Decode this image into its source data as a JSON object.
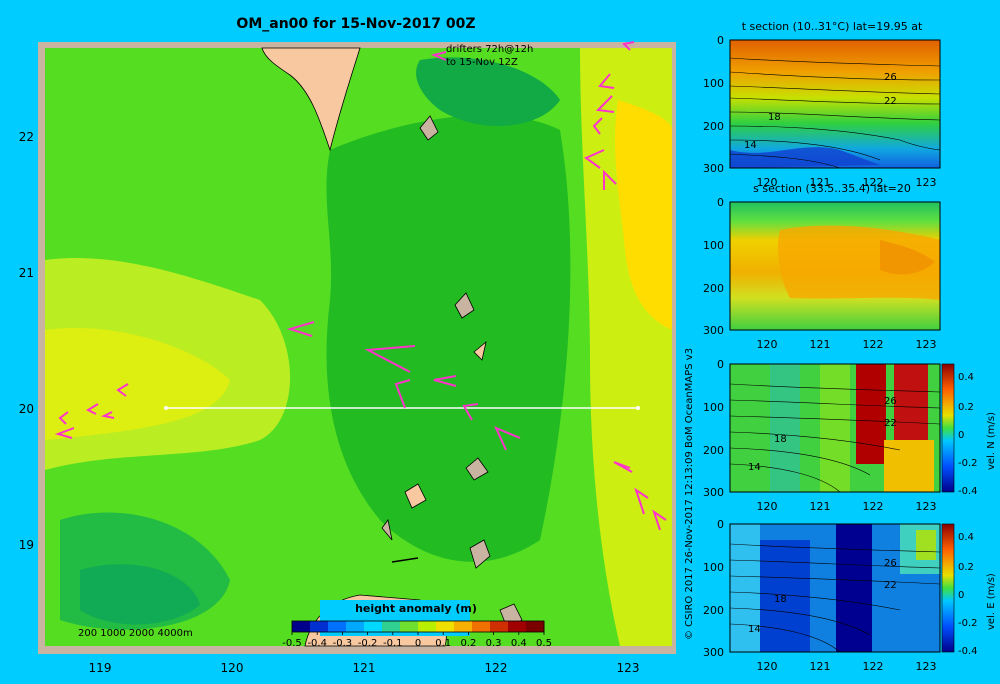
{
  "main_map": {
    "title": "OM_an00 for 15-Nov-2017 00Z",
    "drifters_line1": "drifters 72h@12h",
    "drifters_line2": "to 15-Nov 12Z",
    "lat_ticks": [
      "22",
      "21",
      "20",
      "19"
    ],
    "lon_ticks": [
      "119",
      "120",
      "121",
      "122",
      "123"
    ],
    "depth_legend": "200  1000  2000  4000m",
    "colorbar_title": "height anomaly  (m)",
    "colorbar_ticks": [
      "-0.5",
      "-0.4",
      "-0.3",
      "-0.2",
      "-0.1",
      "0",
      "0.1",
      "0.2",
      "0.3",
      "0.4",
      "0.5"
    ]
  },
  "credit": "© CSIRO 2017   26-Nov-2017 12:13:09 BoM OceanMAPS v3",
  "panels": [
    {
      "title": "t section (10..31°C) lat=19.95 at",
      "y_ticks": [
        "0",
        "100",
        "200",
        "300"
      ],
      "x_ticks": [
        "120",
        "121",
        "122",
        "123"
      ],
      "contour_labels": [
        "26",
        "22",
        "18",
        "14"
      ]
    },
    {
      "title": "s section (33.5..35.4) lat=20",
      "y_ticks": [
        "0",
        "100",
        "200",
        "300"
      ],
      "x_ticks": [
        "120",
        "121",
        "122",
        "123"
      ],
      "contour_labels": []
    },
    {
      "title": "",
      "y_ticks": [
        "0",
        "100",
        "200",
        "300"
      ],
      "x_ticks": [
        "120",
        "121",
        "122",
        "123"
      ],
      "contour_labels": [
        "26",
        "22",
        "18",
        "14"
      ],
      "colorbar_label": "vel. N  (m/s)",
      "colorbar_ticks": [
        "0.4",
        "0.2",
        "0",
        "-0.2",
        "-0.4"
      ]
    },
    {
      "title": "",
      "y_ticks": [
        "0",
        "100",
        "200",
        "300"
      ],
      "x_ticks": [
        "120",
        "121",
        "122",
        "123"
      ],
      "contour_labels": [
        "26",
        "22",
        "18",
        "14"
      ],
      "colorbar_label": "vel. E  (m/s)",
      "colorbar_ticks": [
        "0.4",
        "0.2",
        "0",
        "-0.2",
        "-0.4"
      ]
    }
  ],
  "colors": {
    "background": "#00ccff",
    "land": "#f8c8a0",
    "frame": "#c8b4a0",
    "anomaly_low": "#00a050",
    "anomaly_mid": "#22cc22",
    "anomaly_high": "#ffd000",
    "drifters": "#ff33cc"
  }
}
